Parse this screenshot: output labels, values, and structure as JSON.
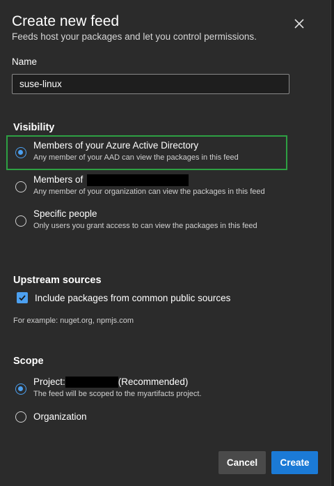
{
  "dialog": {
    "title": "Create new feed",
    "subtitle": "Feeds host your packages and let you control permissions."
  },
  "name_field": {
    "label": "Name",
    "value": "suse-linux"
  },
  "visibility": {
    "heading": "Visibility",
    "options": [
      {
        "title": "Members of your Azure Active Directory",
        "description": "Any member of your AAD can view the packages in this feed",
        "checked": true
      },
      {
        "title": "Members of",
        "description": "Any member of your organization can view the packages in this feed",
        "checked": false
      },
      {
        "title": "Specific people",
        "description": "Only users you grant access to can view the packages in this feed",
        "checked": false
      }
    ]
  },
  "upstream": {
    "heading": "Upstream sources",
    "checkbox_label": "Include packages from common public sources",
    "checked": true,
    "hint": "For example: nuget.org, npmjs.com"
  },
  "scope": {
    "heading": "Scope",
    "options": [
      {
        "title_prefix": "Project:",
        "title_suffix": "(Recommended)",
        "description": "The feed will be scoped to the myartifacts project.",
        "checked": true
      },
      {
        "title": "Organization",
        "checked": false
      }
    ]
  },
  "footer": {
    "cancel_label": "Cancel",
    "create_label": "Create"
  },
  "colors": {
    "accent": "#4ca0f0",
    "primary_button": "#1b7ad6",
    "focus_outline": "#2ea043",
    "background": "#2b2b2b"
  }
}
